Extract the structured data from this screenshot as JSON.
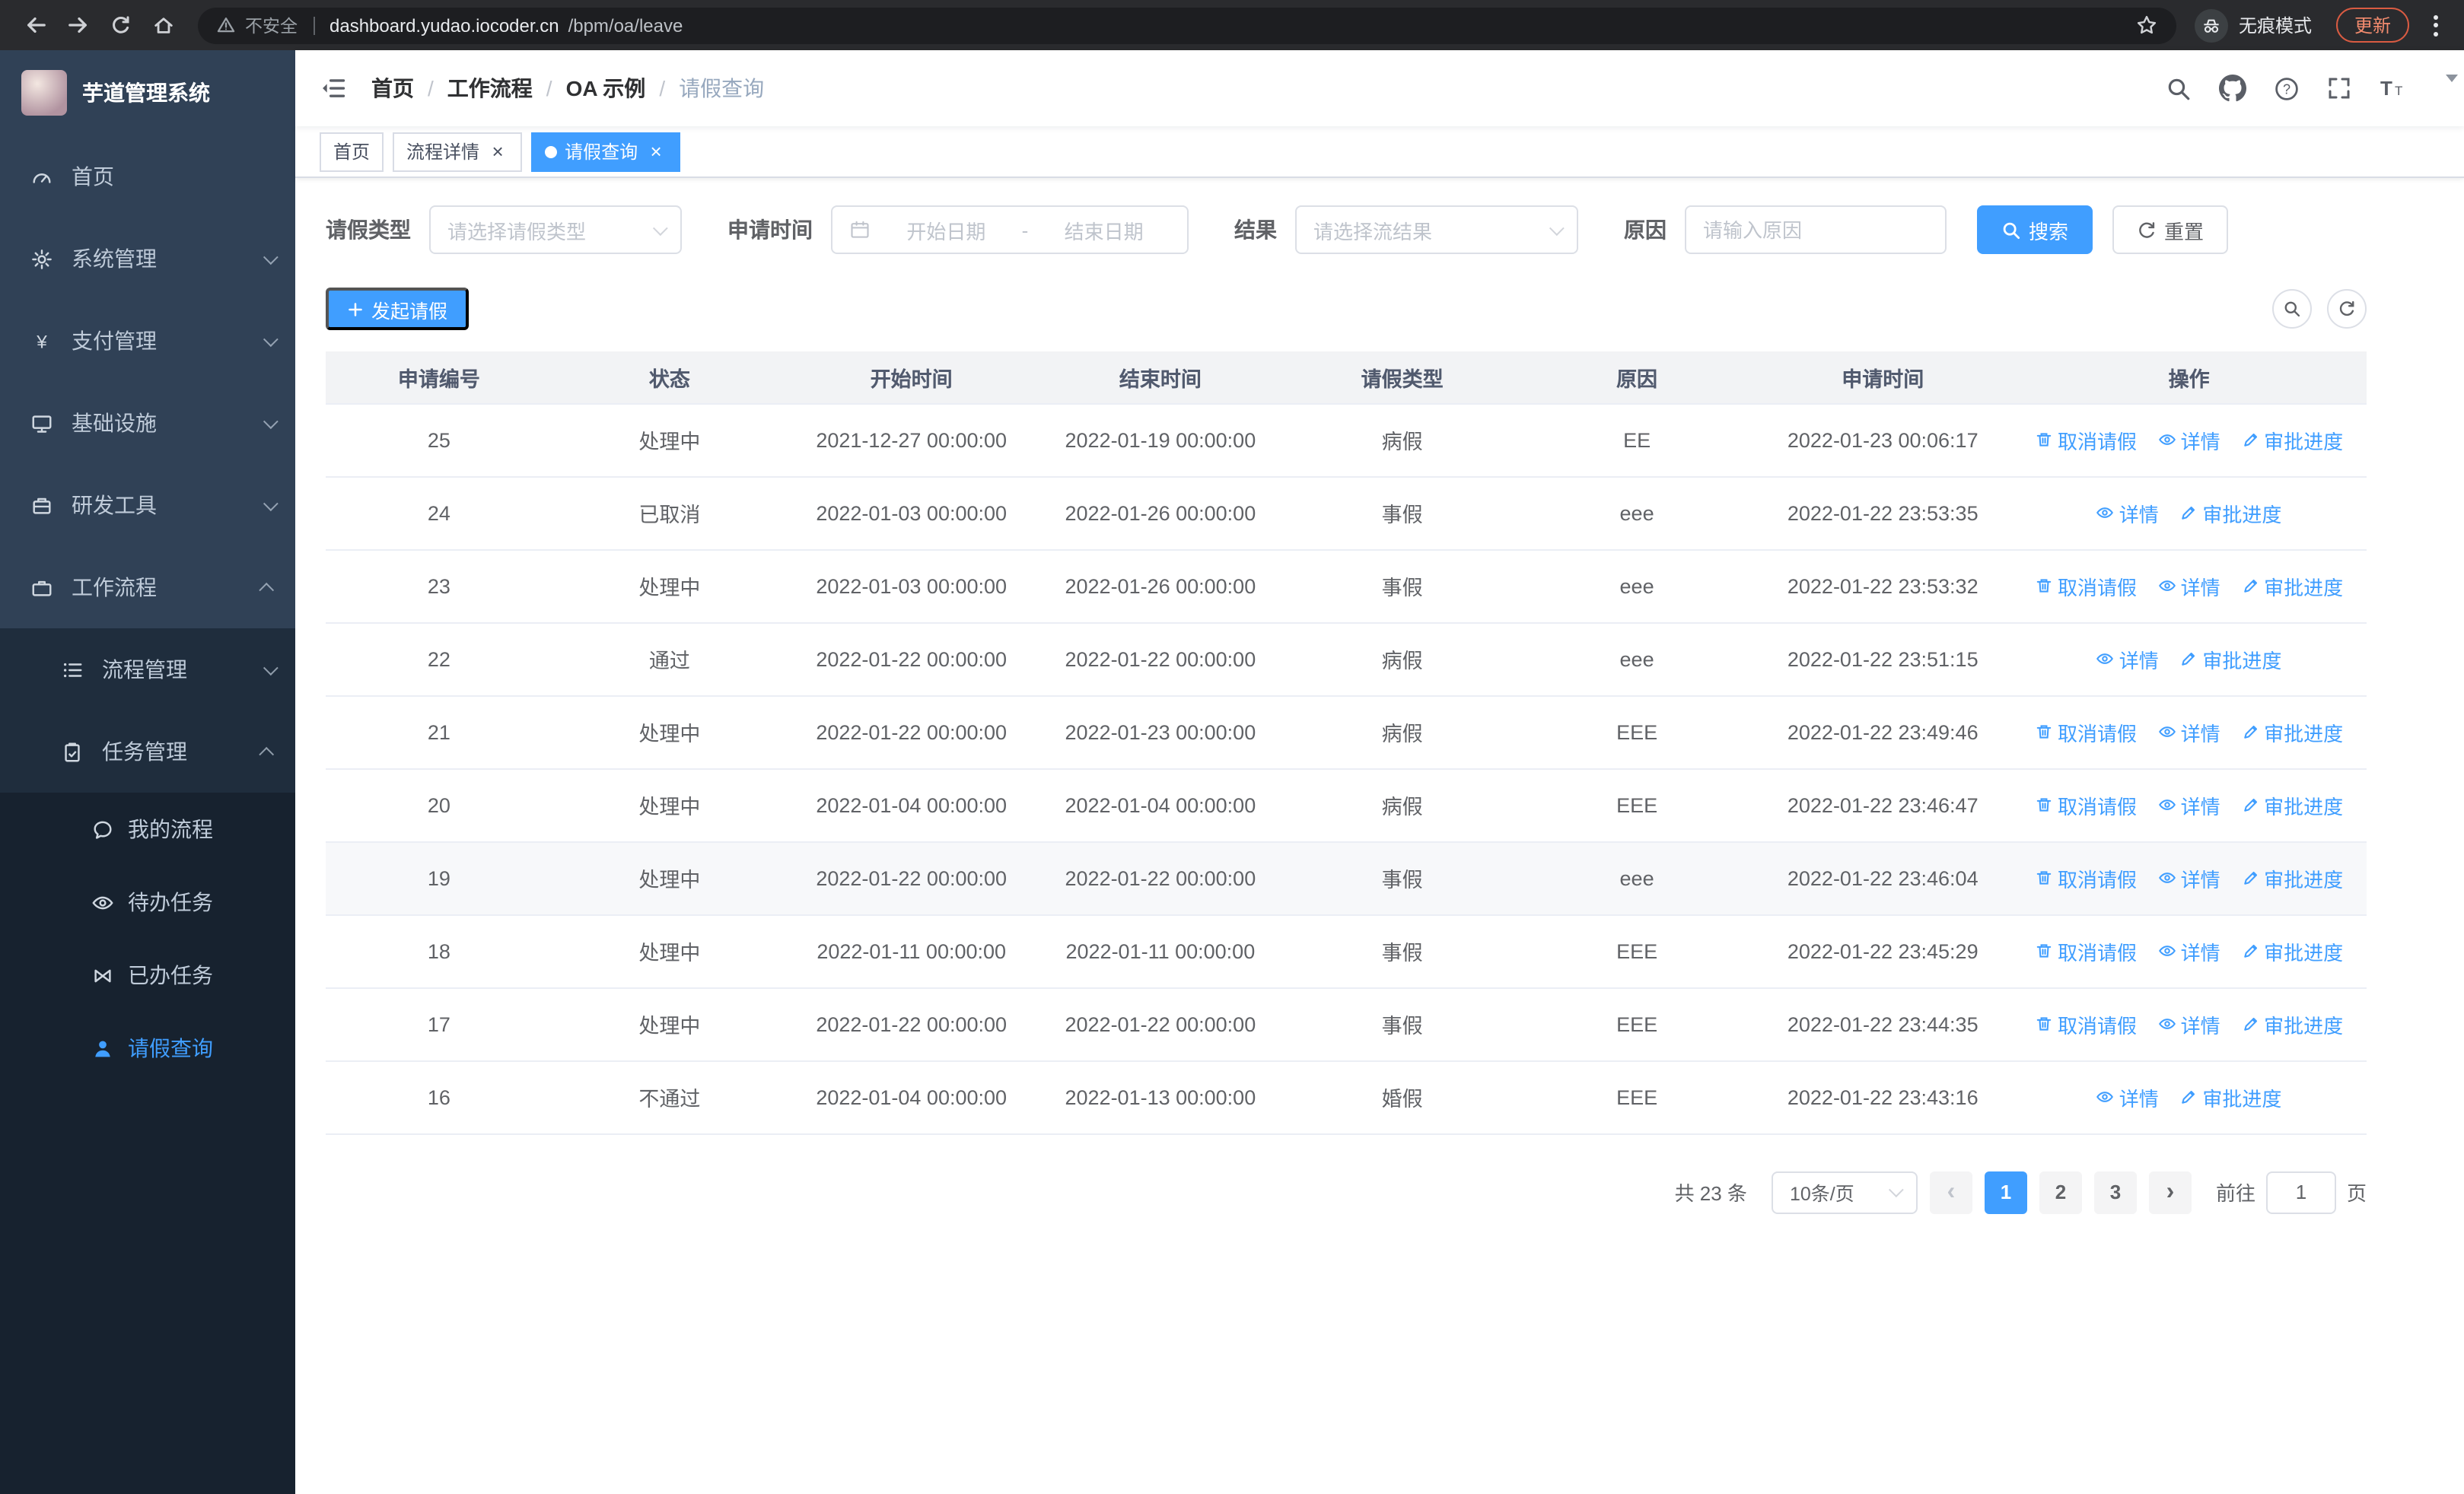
{
  "browser": {
    "security_label": "不安全",
    "url_host": "dashboard.yudao.iocoder.cn",
    "url_path": "/bpm/oa/leave",
    "incognito_label": "无痕模式",
    "update_label": "更新"
  },
  "sidebar": {
    "logo_title": "芋道管理系统",
    "top_items": [
      "首页",
      "系统管理",
      "支付管理",
      "基础设施",
      "研发工具",
      "工作流程"
    ],
    "sub_items": [
      "流程管理",
      "任务管理"
    ],
    "leaf_items": [
      "我的流程",
      "待办任务",
      "已办任务",
      "请假查询"
    ]
  },
  "header": {
    "breadcrumbs": [
      "首页",
      "工作流程",
      "OA 示例",
      "请假查询"
    ]
  },
  "tabs": [
    {
      "label": "首页"
    },
    {
      "label": "流程详情"
    },
    {
      "label": "请假查询"
    }
  ],
  "filters": {
    "leave_type_label": "请假类型",
    "leave_type_placeholder": "请选择请假类型",
    "apply_time_label": "申请时间",
    "start_date_placeholder": "开始日期",
    "range_separator": "-",
    "end_date_placeholder": "结束日期",
    "result_label": "结果",
    "result_placeholder": "请选择流结果",
    "reason_label": "原因",
    "reason_placeholder": "请输入原因",
    "search_label": "搜索",
    "reset_label": "重置"
  },
  "toolbar": {
    "create_label": "发起请假"
  },
  "table": {
    "columns": [
      "申请编号",
      "状态",
      "开始时间",
      "结束时间",
      "请假类型",
      "原因",
      "申请时间",
      "操作"
    ],
    "action_labels": {
      "cancel": "取消请假",
      "detail": "详情",
      "progress": "审批进度"
    },
    "rows": [
      {
        "id": "25",
        "status": "处理中",
        "start": "2021-12-27 00:00:00",
        "end": "2022-01-19 00:00:00",
        "type": "病假",
        "reason": "EE",
        "applied": "2022-01-23 00:06:17",
        "actions": [
          "cancel",
          "detail",
          "progress"
        ],
        "highlighted": false
      },
      {
        "id": "24",
        "status": "已取消",
        "start": "2022-01-03 00:00:00",
        "end": "2022-01-26 00:00:00",
        "type": "事假",
        "reason": "eee",
        "applied": "2022-01-22 23:53:35",
        "actions": [
          "detail",
          "progress"
        ],
        "highlighted": false
      },
      {
        "id": "23",
        "status": "处理中",
        "start": "2022-01-03 00:00:00",
        "end": "2022-01-26 00:00:00",
        "type": "事假",
        "reason": "eee",
        "applied": "2022-01-22 23:53:32",
        "actions": [
          "cancel",
          "detail",
          "progress"
        ],
        "highlighted": false
      },
      {
        "id": "22",
        "status": "通过",
        "start": "2022-01-22 00:00:00",
        "end": "2022-01-22 00:00:00",
        "type": "病假",
        "reason": "eee",
        "applied": "2022-01-22 23:51:15",
        "actions": [
          "detail",
          "progress"
        ],
        "highlighted": false
      },
      {
        "id": "21",
        "status": "处理中",
        "start": "2022-01-22 00:00:00",
        "end": "2022-01-23 00:00:00",
        "type": "病假",
        "reason": "EEE",
        "applied": "2022-01-22 23:49:46",
        "actions": [
          "cancel",
          "detail",
          "progress"
        ],
        "highlighted": false
      },
      {
        "id": "20",
        "status": "处理中",
        "start": "2022-01-04 00:00:00",
        "end": "2022-01-04 00:00:00",
        "type": "病假",
        "reason": "EEE",
        "applied": "2022-01-22 23:46:47",
        "actions": [
          "cancel",
          "detail",
          "progress"
        ],
        "highlighted": false
      },
      {
        "id": "19",
        "status": "处理中",
        "start": "2022-01-22 00:00:00",
        "end": "2022-01-22 00:00:00",
        "type": "事假",
        "reason": "eee",
        "applied": "2022-01-22 23:46:04",
        "actions": [
          "cancel",
          "detail",
          "progress"
        ],
        "highlighted": true
      },
      {
        "id": "18",
        "status": "处理中",
        "start": "2022-01-11 00:00:00",
        "end": "2022-01-11 00:00:00",
        "type": "事假",
        "reason": "EEE",
        "applied": "2022-01-22 23:45:29",
        "actions": [
          "cancel",
          "detail",
          "progress"
        ],
        "highlighted": false
      },
      {
        "id": "17",
        "status": "处理中",
        "start": "2022-01-22 00:00:00",
        "end": "2022-01-22 00:00:00",
        "type": "事假",
        "reason": "EEE",
        "applied": "2022-01-22 23:44:35",
        "actions": [
          "cancel",
          "detail",
          "progress"
        ],
        "highlighted": false
      },
      {
        "id": "16",
        "status": "不通过",
        "start": "2022-01-04 00:00:00",
        "end": "2022-01-13 00:00:00",
        "type": "婚假",
        "reason": "EEE",
        "applied": "2022-01-22 23:43:16",
        "actions": [
          "detail",
          "progress"
        ],
        "highlighted": false
      }
    ]
  },
  "pagination": {
    "total_text": "共 23 条",
    "page_size_label": "10条/页",
    "pages": [
      "1",
      "2",
      "3"
    ],
    "active_page": "1",
    "goto_label": "前往",
    "goto_value": "1",
    "unit_label": "页"
  },
  "colors": {
    "primary": "#409eff",
    "sidebar": "#304156"
  }
}
